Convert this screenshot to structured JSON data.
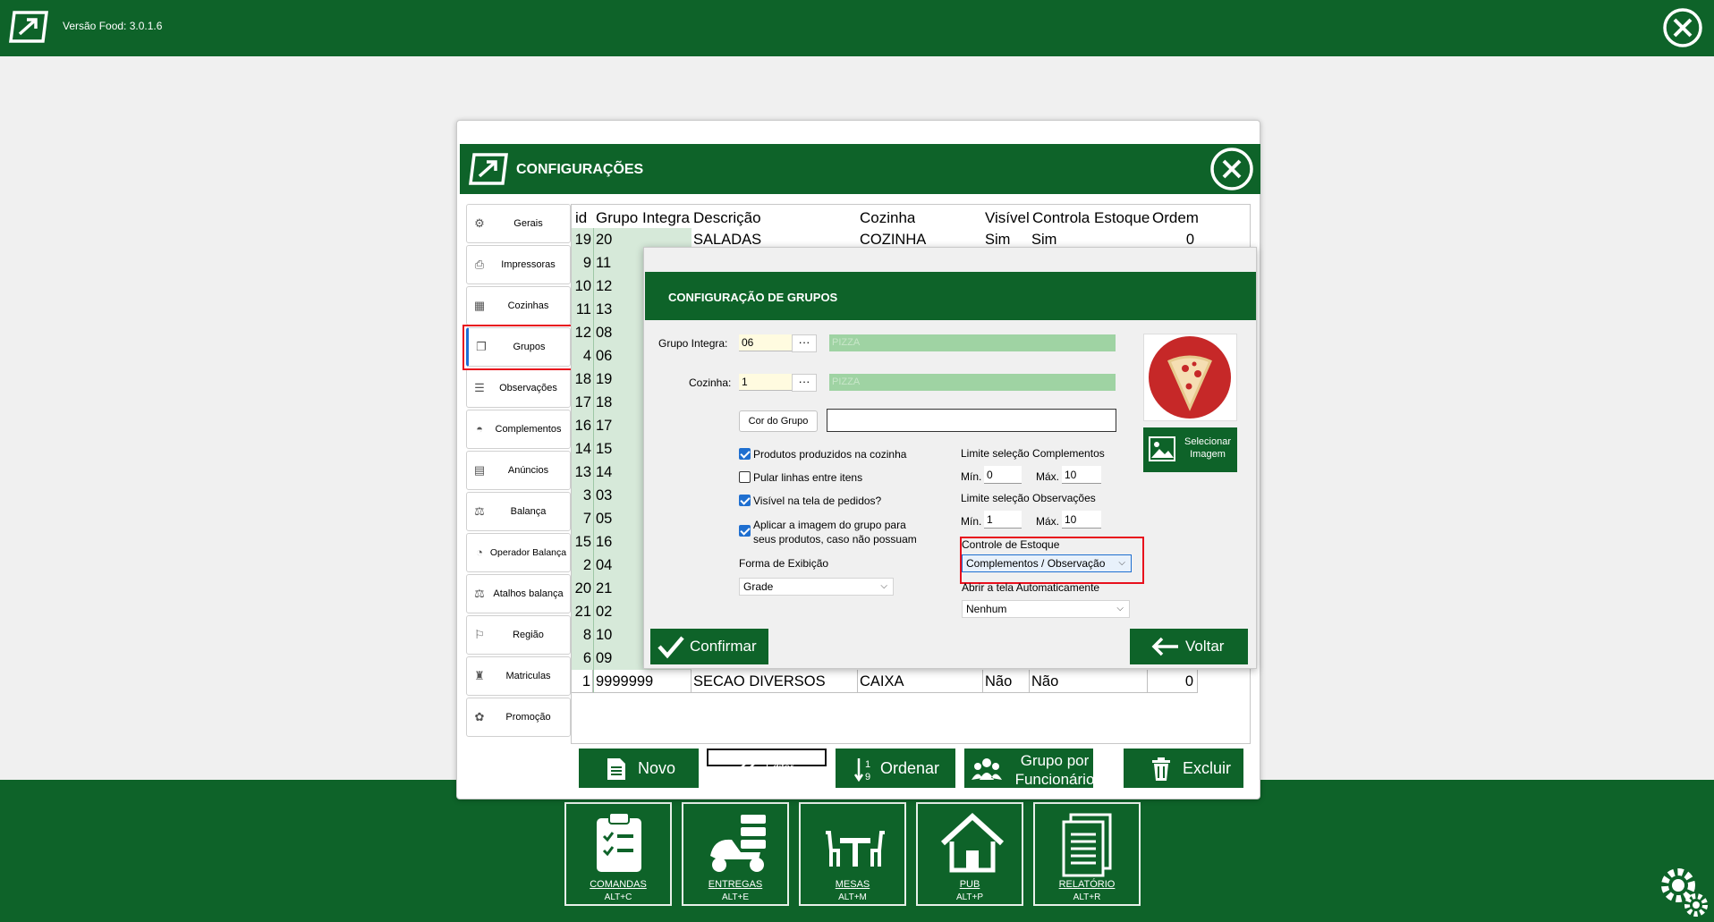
{
  "app": {
    "version": "Versão Food: 3.0.1.6"
  },
  "config": {
    "title": "CONFIGURAÇÕES",
    "sidebar": [
      {
        "label": "Gerais",
        "icon": "settings-icon"
      },
      {
        "label": "Impressoras",
        "icon": "printer-icon"
      },
      {
        "label": "Cozinhas",
        "icon": "kitchen-icon"
      },
      {
        "label": "Grupos",
        "icon": "groups-icon"
      },
      {
        "label": "Observações",
        "icon": "notes-icon"
      },
      {
        "label": "Complementos",
        "icon": "bowl-icon"
      },
      {
        "label": "Anúncios",
        "icon": "document-icon"
      },
      {
        "label": "Balança",
        "icon": "scale-icon"
      },
      {
        "label": "Operador  Balança",
        "icon": "operator-icon"
      },
      {
        "label": "Atalhos balança",
        "icon": "scale-shortcut-icon"
      },
      {
        "label": "Região",
        "icon": "flag-icon"
      },
      {
        "label": "Matriculas",
        "icon": "enrollment-icon"
      },
      {
        "label": "Promoção",
        "icon": "promotion-icon"
      }
    ],
    "table": {
      "columns": [
        "id",
        "Grupo Integra",
        "Descrição",
        "Cozinha",
        "Visível",
        "Controla Estoque",
        "Ordem"
      ],
      "rows": [
        {
          "id": "19",
          "gi": "20",
          "desc": "SALADAS",
          "coz": "COZINHA",
          "vis": "Sim",
          "ce": "Sim",
          "ord": "0"
        },
        {
          "id": "9",
          "gi": "11"
        },
        {
          "id": "10",
          "gi": "12"
        },
        {
          "id": "11",
          "gi": "13"
        },
        {
          "id": "12",
          "gi": "08"
        },
        {
          "id": "4",
          "gi": "06"
        },
        {
          "id": "18",
          "gi": "19"
        },
        {
          "id": "17",
          "gi": "18"
        },
        {
          "id": "16",
          "gi": "17"
        },
        {
          "id": "14",
          "gi": "15"
        },
        {
          "id": "13",
          "gi": "14"
        },
        {
          "id": "3",
          "gi": "03"
        },
        {
          "id": "7",
          "gi": "05"
        },
        {
          "id": "15",
          "gi": "16"
        },
        {
          "id": "2",
          "gi": "04"
        },
        {
          "id": "20",
          "gi": "21"
        },
        {
          "id": "21",
          "gi": "02"
        },
        {
          "id": "8",
          "gi": "10"
        },
        {
          "id": "6",
          "gi": "09"
        },
        {
          "id": "1",
          "gi": "9999999",
          "desc": "SECAO  DIVERSOS",
          "coz": "CAIXA",
          "vis": "Não",
          "ce": "Não",
          "ord": "0"
        }
      ]
    },
    "actions": {
      "novo": "Novo",
      "editar": "Editar",
      "ordenar": "Ordenar",
      "grupo_func_1": "Grupo por",
      "grupo_func_2": "Funcionário",
      "excluir": "Excluir"
    }
  },
  "dialog": {
    "title": "CONFIGURAÇÃO DE GRUPOS",
    "grupo_integra_label": "Grupo Integra:",
    "grupo_integra_value": "06",
    "grupo_integra_name": "PIZZA",
    "cozinha_label": "Cozinha:",
    "cozinha_value": "1",
    "cozinha_name": "PIZZA",
    "dots": "···",
    "cor_button": "Cor do Grupo",
    "checkboxes": [
      {
        "label": "Produtos produzidos na cozinha",
        "checked": true
      },
      {
        "label": "Pular linhas entre itens",
        "checked": false
      },
      {
        "label": "Visível na tela de pedidos?",
        "checked": true
      },
      {
        "label": "Aplicar a imagem do grupo para",
        "label2": "seus produtos, caso não possuam",
        "checked": true
      }
    ],
    "forma_label": "Forma de Exibição",
    "forma_value": "Grade",
    "limite_comp_label": "Limite seleção Complementos",
    "limite_obs_label": "Limite seleção Observações",
    "min_label": "Mín.",
    "max_label": "Máx.",
    "comp_min": "0",
    "comp_max": "10",
    "obs_min": "1",
    "obs_max": "10",
    "estoque_label": "Controle de Estoque",
    "estoque_value": "Complementos / Observação",
    "abrir_label": "Abrir a tela Automaticamente",
    "abrir_value": "Nenhum",
    "select_image_1": "Selecionar",
    "select_image_2": "Imagem",
    "confirm": "Confirmar",
    "back": "Voltar"
  },
  "bottom_nav": [
    {
      "label": "COMANDAS",
      "shortcut": "ALT+C"
    },
    {
      "label": "ENTREGAS",
      "shortcut": "ALT+E"
    },
    {
      "label": "MESAS",
      "shortcut": "ALT+M"
    },
    {
      "label": "PUB",
      "shortcut": "ALT+P"
    },
    {
      "label": "RELATÓRIO",
      "shortcut": "ALT+R"
    }
  ],
  "colors": {
    "brand_green": "#0e6329",
    "highlight_red": "#e8101d",
    "row_green": "#d6e9d9",
    "check_blue": "#1f6fd0"
  }
}
